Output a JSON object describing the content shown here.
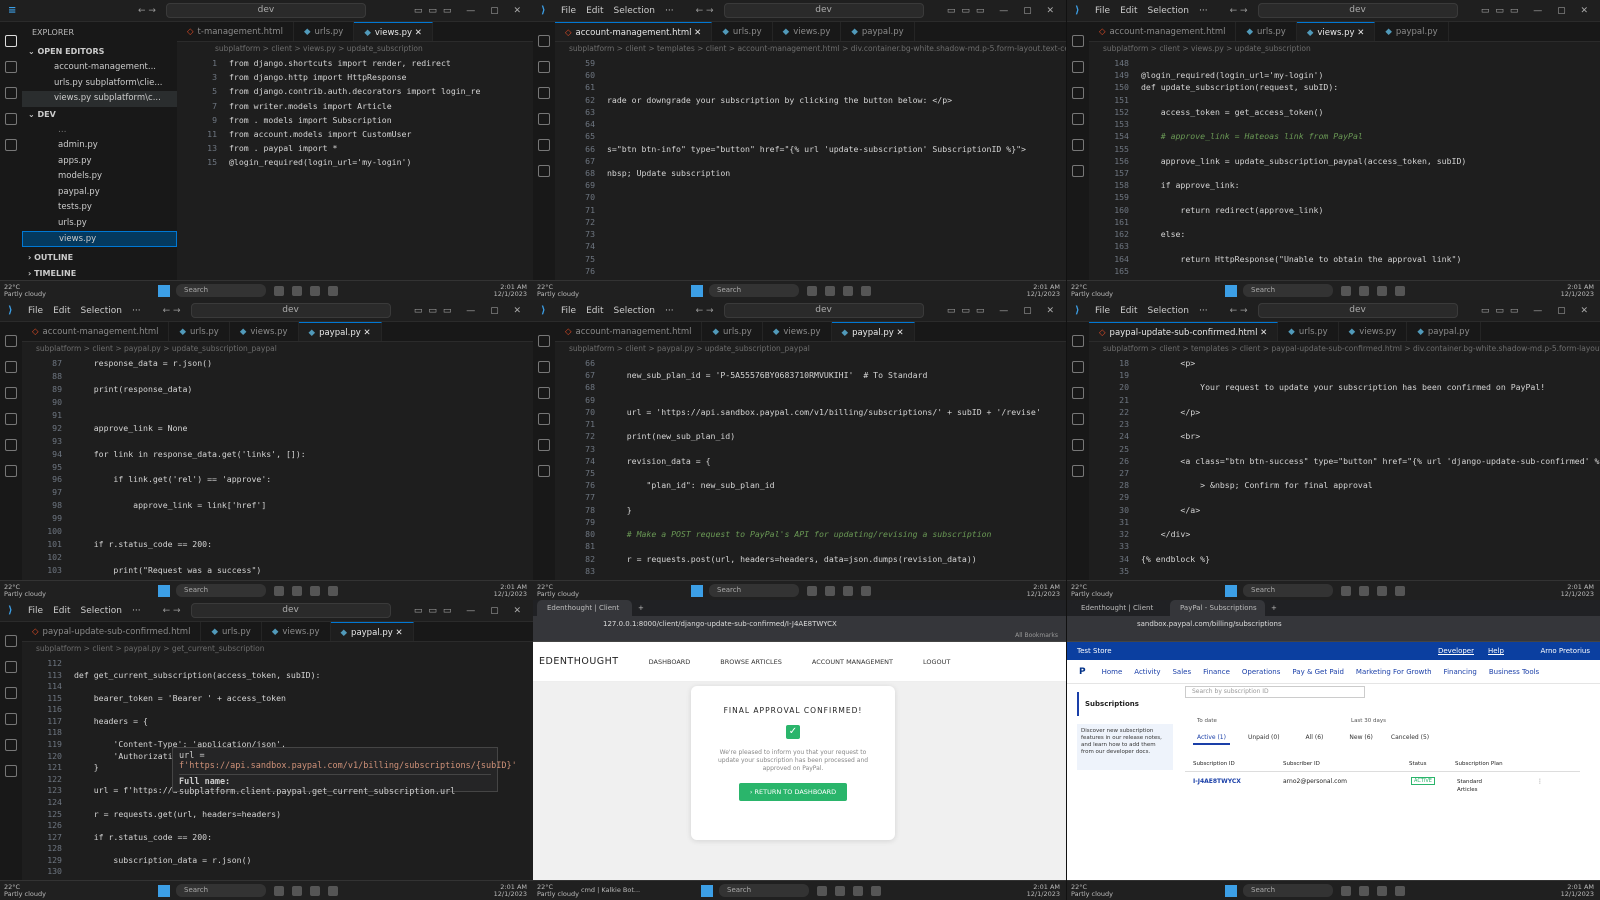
{
  "menu": {
    "file": "File",
    "edit": "Edit",
    "selection": "Selection",
    "more": "···",
    "search": "dev"
  },
  "taskbar": {
    "weather1": "22°C",
    "weather2": "Partly cloudy",
    "search": "Search",
    "tray": "2:01 AM",
    "date": "12/1/2023"
  },
  "p1": {
    "explorer_title": "EXPLORER",
    "open_editors": "OPEN EDITORS",
    "oe_items": [
      "account-management...",
      "urls.py subplatform\\clie...",
      "views.py subplatform\\c..."
    ],
    "dev": "DEV",
    "files": [
      "admin.py",
      "apps.py",
      "models.py",
      "paypal.py",
      "tests.py",
      "urls.py",
      "views.py"
    ],
    "outline": "OUTLINE",
    "timeline": "TIMELINE",
    "tabs": [
      "t-management.html",
      "urls.py",
      "views.py"
    ],
    "breadcrumb": "subplatform > client > views.py > update_subscription",
    "lines": [
      {
        "n": "1",
        "t": "from django.shortcuts import render, redirect"
      },
      {
        "n": "3",
        "t": "from django.http import HttpResponse"
      },
      {
        "n": "5",
        "t": "from django.contrib.auth.decorators import login_re"
      },
      {
        "n": "7",
        "t": "from writer.models import Article"
      },
      {
        "n": "9",
        "t": "from . models import Subscription"
      },
      {
        "n": "11",
        "t": "from account.models import CustomUser"
      },
      {
        "n": "13",
        "t": "from . paypal import *"
      },
      {
        "n": "15",
        "t": "@login_required(login_url='my-login')"
      }
    ]
  },
  "p2": {
    "tabs": [
      "account-management.html",
      "urls.py",
      "views.py",
      "paypal.py"
    ],
    "breadcrumb": "subplatform > client > templates > client > account-management.html > div.container.bg-white.shadow-md.p-5.form-layout.text-center",
    "lines": [
      {
        "n": "59",
        "t": ""
      },
      {
        "n": "60",
        "t": ""
      },
      {
        "n": "61",
        "t": ""
      },
      {
        "n": "62",
        "t": "rade or downgrade your subscription by clicking the button below: </p>"
      },
      {
        "n": "63",
        "t": ""
      },
      {
        "n": "64",
        "t": ""
      },
      {
        "n": "65",
        "t": ""
      },
      {
        "n": "66",
        "t": "s=\"btn btn-info\" type=\"button\" href=\"{% url 'update-subscription' SubscriptionID %}\">"
      },
      {
        "n": "67",
        "t": ""
      },
      {
        "n": "68",
        "t": "nbsp; Update subscription"
      },
      {
        "n": "69",
        "t": ""
      },
      {
        "n": "70",
        "t": ""
      },
      {
        "n": "71",
        "t": ""
      },
      {
        "n": "72",
        "t": ""
      },
      {
        "n": "73",
        "t": ""
      },
      {
        "n": "74",
        "t": ""
      },
      {
        "n": "75",
        "t": ""
      },
      {
        "n": "76",
        "t": ""
      }
    ]
  },
  "p3": {
    "tabs": [
      "account-management.html",
      "urls.py",
      "views.py",
      "paypal.py"
    ],
    "breadcrumb": "subplatform > client > views.py > update_subscription",
    "lines": [
      {
        "n": "148",
        "t": ""
      },
      {
        "n": "149",
        "t": "@login_required(login_url='my-login')"
      },
      {
        "n": "150",
        "t": "def update_subscription(request, subID):"
      },
      {
        "n": "151",
        "t": ""
      },
      {
        "n": "152",
        "t": "    access_token = get_access_token()"
      },
      {
        "n": "153",
        "t": ""
      },
      {
        "n": "154",
        "t": "    # approve_link = Hateoas link from PayPal"
      },
      {
        "n": "155",
        "t": ""
      },
      {
        "n": "156",
        "t": "    approve_link = update_subscription_paypal(access_token, subID)"
      },
      {
        "n": "157",
        "t": ""
      },
      {
        "n": "158",
        "t": "    if approve_link:"
      },
      {
        "n": "159",
        "t": ""
      },
      {
        "n": "160",
        "t": "        return redirect(approve_link)"
      },
      {
        "n": "161",
        "t": ""
      },
      {
        "n": "162",
        "t": "    else:"
      },
      {
        "n": "163",
        "t": ""
      },
      {
        "n": "164",
        "t": "        return HttpResponse(\"Unable to obtain the approval link\")"
      },
      {
        "n": "165",
        "t": ""
      }
    ]
  },
  "p4": {
    "tabs": [
      "account-management.html",
      "urls.py",
      "views.py",
      "paypal.py"
    ],
    "breadcrumb": "subplatform > client > paypal.py > update_subscription_paypal",
    "lines": [
      {
        "n": "87",
        "t": "    response_data = r.json()"
      },
      {
        "n": "88",
        "t": ""
      },
      {
        "n": "89",
        "t": "    print(response_data)"
      },
      {
        "n": "90",
        "t": ""
      },
      {
        "n": "91",
        "t": ""
      },
      {
        "n": "92",
        "t": "    approve_link = None"
      },
      {
        "n": "93",
        "t": ""
      },
      {
        "n": "94",
        "t": "    for link in response_data.get('links', []):"
      },
      {
        "n": "95",
        "t": ""
      },
      {
        "n": "96",
        "t": "        if link.get('rel') == 'approve':"
      },
      {
        "n": "97",
        "t": ""
      },
      {
        "n": "98",
        "t": "            approve_link = link['href']"
      },
      {
        "n": "99",
        "t": ""
      },
      {
        "n": "100",
        "t": ""
      },
      {
        "n": "101",
        "t": "    if r.status_code == 200:"
      },
      {
        "n": "102",
        "t": ""
      },
      {
        "n": "103",
        "t": "        print(\"Request was a success\")"
      }
    ]
  },
  "p5": {
    "tabs": [
      "account-management.html",
      "urls.py",
      "views.py",
      "paypal.py"
    ],
    "breadcrumb": "subplatform > client > paypal.py > update_subscription_paypal",
    "lines": [
      {
        "n": "66",
        "t": ""
      },
      {
        "n": "67",
        "t": "    new_sub_plan_id = 'P-5A55576BY0683710RMVUKIHI'  # To Standard"
      },
      {
        "n": "68",
        "t": ""
      },
      {
        "n": "69",
        "t": ""
      },
      {
        "n": "70",
        "t": "    url = 'https://api.sandbox.paypal.com/v1/billing/subscriptions/' + subID + '/revise'"
      },
      {
        "n": "71",
        "t": ""
      },
      {
        "n": "72",
        "t": "    print(new_sub_plan_id)"
      },
      {
        "n": "73",
        "t": ""
      },
      {
        "n": "74",
        "t": "    revision_data = {"
      },
      {
        "n": "75",
        "t": ""
      },
      {
        "n": "76",
        "t": "        \"plan_id\": new_sub_plan_id"
      },
      {
        "n": "77",
        "t": ""
      },
      {
        "n": "78",
        "t": "    }"
      },
      {
        "n": "79",
        "t": ""
      },
      {
        "n": "80",
        "t": "    # Make a POST request to PayPal's API for updating/revising a subscription"
      },
      {
        "n": "81",
        "t": ""
      },
      {
        "n": "82",
        "t": "    r = requests.post(url, headers=headers, data=json.dumps(revision_data))"
      },
      {
        "n": "83",
        "t": ""
      }
    ]
  },
  "p6": {
    "tabs": [
      "paypal-update-sub-confirmed.html",
      "urls.py",
      "views.py",
      "paypal.py"
    ],
    "breadcrumb": "subplatform > client > templates > client > paypal-update-sub-confirmed.html > div.container.bg-white.shadow-md.p-5.form-layout",
    "lines": [
      {
        "n": "18",
        "t": "        <p>"
      },
      {
        "n": "19",
        "t": ""
      },
      {
        "n": "20",
        "t": "            Your request to update your subscription has been confirmed on PayPal!"
      },
      {
        "n": "21",
        "t": ""
      },
      {
        "n": "22",
        "t": "        </p>"
      },
      {
        "n": "23",
        "t": ""
      },
      {
        "n": "24",
        "t": "        <br>"
      },
      {
        "n": "25",
        "t": ""
      },
      {
        "n": "26",
        "t": "        <a class=\"btn btn-success\" type=\"button\" href=\"{% url 'django-update-sub-confirmed' %}\">"
      },
      {
        "n": "27",
        "t": ""
      },
      {
        "n": "28",
        "t": "            > &nbsp; Confirm for final approval"
      },
      {
        "n": "29",
        "t": ""
      },
      {
        "n": "30",
        "t": "        </a>"
      },
      {
        "n": "31",
        "t": ""
      },
      {
        "n": "32",
        "t": "    </div>"
      },
      {
        "n": "33",
        "t": ""
      },
      {
        "n": "34",
        "t": "{% endblock %}"
      },
      {
        "n": "35",
        "t": ""
      }
    ]
  },
  "p7": {
    "tabs": [
      "paypal-update-sub-confirmed.html",
      "urls.py",
      "views.py",
      "paypal.py"
    ],
    "breadcrumb": "subplatform > client > paypal.py > get_current_subscription",
    "lines": [
      {
        "n": "112",
        "t": ""
      },
      {
        "n": "113",
        "t": "def get_current_subscription(access_token, subID):"
      },
      {
        "n": "114",
        "t": ""
      },
      {
        "n": "115",
        "t": "    bearer_token = 'Bearer ' + access_token"
      },
      {
        "n": "116",
        "t": ""
      },
      {
        "n": "117",
        "t": "    headers = {"
      },
      {
        "n": "118",
        "t": ""
      },
      {
        "n": "119",
        "t": "        'Content-Type': 'application/json',"
      },
      {
        "n": "120",
        "t": "        'Authorization': bearer_token,"
      },
      {
        "n": "121",
        "t": "    }"
      },
      {
        "n": "122",
        "t": ""
      },
      {
        "n": "123",
        "t": "    url = f'https://a"
      },
      {
        "n": "124",
        "t": ""
      },
      {
        "n": "125",
        "t": "    r = requests.get(url, headers=headers)"
      },
      {
        "n": "126",
        "t": ""
      },
      {
        "n": "127",
        "t": "    if r.status_code == 200:"
      },
      {
        "n": "128",
        "t": ""
      },
      {
        "n": "129",
        "t": "        subscription_data = r.json()"
      },
      {
        "n": "130",
        "t": ""
      }
    ],
    "tooltip_l1": "url =",
    "tooltip_l2": "f'https://api.sandbox.paypal.com/v1/billing/subscriptions/{subID}'",
    "tooltip_l3_label": "Full name:",
    "tooltip_l3": "subplatform.client.paypal.get_current_subscription.url"
  },
  "p8": {
    "tab": "Edenthought | Client",
    "url": "127.0.0.1:8000/client/django-update-sub-confirmed/I-J4AE8TWYCX",
    "bookmarks": "All Bookmarks",
    "brand": "EDENTHOUGHT",
    "nav": [
      "DASHBOARD",
      "BROWSE ARTICLES",
      "ACCOUNT MANAGEMENT",
      "LOGOUT"
    ],
    "title": "FINAL APPROVAL CONFIRMED!",
    "body": "We're pleased to inform you that your request to update your subscription has been processed and approved on PayPal.",
    "button": "RETURN TO DASHBOARD",
    "task_item": "cmd | Kalkie Bot..."
  },
  "p9": {
    "tabs": [
      "Edenthought | Client",
      "PayPal - Subscriptions"
    ],
    "url": "sandbox.paypal.com/billing/subscriptions",
    "store": "Test Store",
    "top_links": [
      "Developer",
      "Help"
    ],
    "user": "Arno Pretorius",
    "nav": [
      "Home",
      "Activity",
      "Sales",
      "Finance",
      "Operations",
      "Pay & Get Paid",
      "Marketing For Growth",
      "Financing",
      "Business Tools"
    ],
    "side_title": "Subscriptions",
    "promo": "Discover new subscription features in our release notes, and learn how to add them from our developer docs.",
    "search_placeholder": "Search by subscription ID",
    "to_date": "To date",
    "last30": "Last 30 days",
    "filters": [
      "Active (1)",
      "Unpaid (0)",
      "All (6)",
      "New (6)",
      "Canceled (5)"
    ],
    "cols": [
      "Subscription ID",
      "Subscriber ID",
      "Status",
      "Subscription Plan"
    ],
    "row": {
      "id": "I-J4AE8TWYCX",
      "email": "arno2@personal.com",
      "status": "ACTIVE",
      "plan": "Standard Articles"
    }
  }
}
